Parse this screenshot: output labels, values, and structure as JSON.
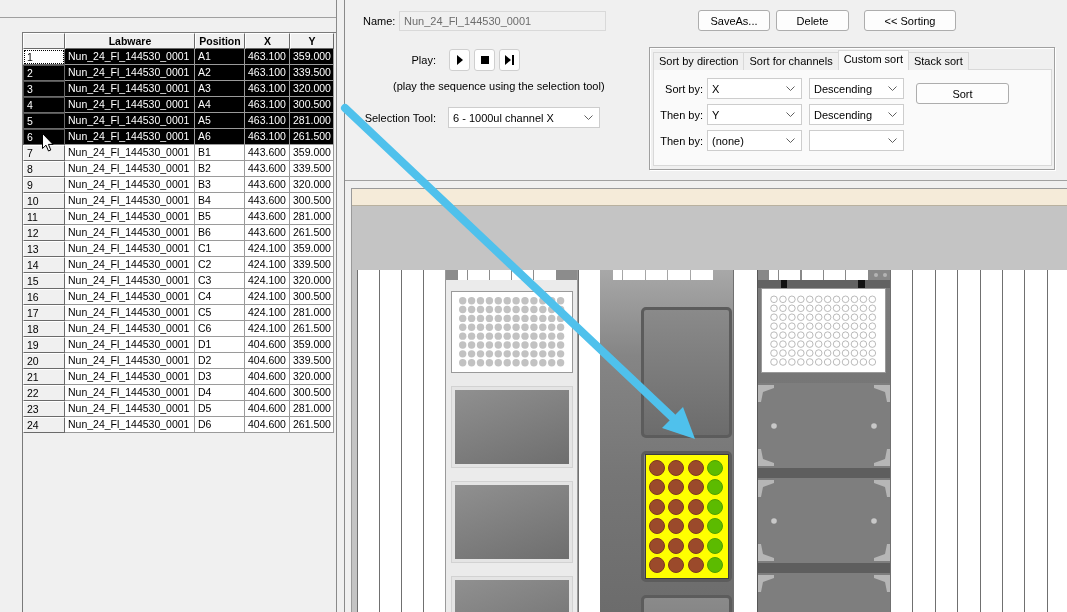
{
  "table": {
    "columns": [
      "Labware",
      "Position",
      "X",
      "Y"
    ],
    "rows": [
      {
        "number": "1",
        "cells": [
          "Nun_24_Fl_144530_0001",
          "A1",
          "463.100",
          "359.000"
        ],
        "selected": true,
        "focused": true
      },
      {
        "number": "2",
        "cells": [
          "Nun_24_Fl_144530_0001",
          "A2",
          "463.100",
          "339.500"
        ],
        "selected": true,
        "focused": false
      },
      {
        "number": "3",
        "cells": [
          "Nun_24_Fl_144530_0001",
          "A3",
          "463.100",
          "320.000"
        ],
        "selected": true,
        "focused": false
      },
      {
        "number": "4",
        "cells": [
          "Nun_24_Fl_144530_0001",
          "A4",
          "463.100",
          "300.500"
        ],
        "selected": true,
        "focused": false
      },
      {
        "number": "5",
        "cells": [
          "Nun_24_Fl_144530_0001",
          "A5",
          "463.100",
          "281.000"
        ],
        "selected": true,
        "focused": false
      },
      {
        "number": "6",
        "cells": [
          "Nun_24_Fl_144530_0001",
          "A6",
          "463.100",
          "261.500"
        ],
        "selected": true,
        "focused": false
      },
      {
        "number": "7",
        "cells": [
          "Nun_24_Fl_144530_0001",
          "B1",
          "443.600",
          "359.000"
        ],
        "selected": false,
        "focused": false
      },
      {
        "number": "8",
        "cells": [
          "Nun_24_Fl_144530_0001",
          "B2",
          "443.600",
          "339.500"
        ],
        "selected": false,
        "focused": false
      },
      {
        "number": "9",
        "cells": [
          "Nun_24_Fl_144530_0001",
          "B3",
          "443.600",
          "320.000"
        ],
        "selected": false,
        "focused": false
      },
      {
        "number": "10",
        "cells": [
          "Nun_24_Fl_144530_0001",
          "B4",
          "443.600",
          "300.500"
        ],
        "selected": false,
        "focused": false
      },
      {
        "number": "11",
        "cells": [
          "Nun_24_Fl_144530_0001",
          "B5",
          "443.600",
          "281.000"
        ],
        "selected": false,
        "focused": false
      },
      {
        "number": "12",
        "cells": [
          "Nun_24_Fl_144530_0001",
          "B6",
          "443.600",
          "261.500"
        ],
        "selected": false,
        "focused": false
      },
      {
        "number": "13",
        "cells": [
          "Nun_24_Fl_144530_0001",
          "C1",
          "424.100",
          "359.000"
        ],
        "selected": false,
        "focused": false
      },
      {
        "number": "14",
        "cells": [
          "Nun_24_Fl_144530_0001",
          "C2",
          "424.100",
          "339.500"
        ],
        "selected": false,
        "focused": false
      },
      {
        "number": "15",
        "cells": [
          "Nun_24_Fl_144530_0001",
          "C3",
          "424.100",
          "320.000"
        ],
        "selected": false,
        "focused": false
      },
      {
        "number": "16",
        "cells": [
          "Nun_24_Fl_144530_0001",
          "C4",
          "424.100",
          "300.500"
        ],
        "selected": false,
        "focused": false
      },
      {
        "number": "17",
        "cells": [
          "Nun_24_Fl_144530_0001",
          "C5",
          "424.100",
          "281.000"
        ],
        "selected": false,
        "focused": false
      },
      {
        "number": "18",
        "cells": [
          "Nun_24_Fl_144530_0001",
          "C6",
          "424.100",
          "261.500"
        ],
        "selected": false,
        "focused": false
      },
      {
        "number": "19",
        "cells": [
          "Nun_24_Fl_144530_0001",
          "D1",
          "404.600",
          "359.000"
        ],
        "selected": false,
        "focused": false
      },
      {
        "number": "20",
        "cells": [
          "Nun_24_Fl_144530_0001",
          "D2",
          "404.600",
          "339.500"
        ],
        "selected": false,
        "focused": false
      },
      {
        "number": "21",
        "cells": [
          "Nun_24_Fl_144530_0001",
          "D3",
          "404.600",
          "320.000"
        ],
        "selected": false,
        "focused": false
      },
      {
        "number": "22",
        "cells": [
          "Nun_24_Fl_144530_0001",
          "D4",
          "404.600",
          "300.500"
        ],
        "selected": false,
        "focused": false
      },
      {
        "number": "23",
        "cells": [
          "Nun_24_Fl_144530_0001",
          "D5",
          "404.600",
          "281.000"
        ],
        "selected": false,
        "focused": false
      },
      {
        "number": "24",
        "cells": [
          "Nun_24_Fl_144530_0001",
          "D6",
          "404.600",
          "261.500"
        ],
        "selected": false,
        "focused": false
      }
    ]
  },
  "name_field": {
    "label": "Name:",
    "value": "Nun_24_Fl_144530_0001",
    "disabled": true
  },
  "buttons": [
    "SaveAs...",
    "Delete",
    "<< Sorting"
  ],
  "play": {
    "label": "Play:",
    "buttons": [
      {
        "kind": "play"
      },
      {
        "kind": "stop"
      },
      {
        "kind": "step"
      }
    ],
    "hint": "(play the sequence using the selection tool)"
  },
  "selection_tool": {
    "label": "Selection Tool:",
    "value": "6 - 1000ul channel X"
  },
  "sort_panel": {
    "tabs": [
      {
        "label": "Sort by direction",
        "selected": false
      },
      {
        "label": "Sort for channels",
        "selected": false
      },
      {
        "label": "Custom sort",
        "selected": true
      },
      {
        "label": "Stack sort",
        "selected": false
      }
    ],
    "rows": [
      {
        "label": "Sort by:",
        "field": "X",
        "order": "Descending"
      },
      {
        "label": "Then by:",
        "field": "Y",
        "order": "Descending"
      },
      {
        "label": "Then by:",
        "field": "(none)"
      }
    ],
    "button": "Sort"
  },
  "deck": {
    "carriers": [
      {
        "kind": "light",
        "slots": [
          {
            "kind": "plate96",
            "filled": true
          },
          {
            "kind": "empty"
          },
          {
            "kind": "empty"
          },
          {
            "kind": "empty"
          }
        ]
      },
      {
        "kind": "dark",
        "slots": [
          {
            "kind": "holder"
          },
          {
            "kind": "plate24",
            "highlighted": true,
            "well_rows": [
              {
                "wells": [
                  {
                    "selected": false
                  },
                  {
                    "selected": false
                  },
                  {
                    "selected": false
                  },
                  {
                    "selected": true
                  }
                ]
              },
              {
                "wells": [
                  {
                    "selected": false
                  },
                  {
                    "selected": false
                  },
                  {
                    "selected": false
                  },
                  {
                    "selected": true
                  }
                ]
              },
              {
                "wells": [
                  {
                    "selected": false
                  },
                  {
                    "selected": false
                  },
                  {
                    "selected": false
                  },
                  {
                    "selected": true
                  }
                ]
              },
              {
                "wells": [
                  {
                    "selected": false
                  },
                  {
                    "selected": false
                  },
                  {
                    "selected": false
                  },
                  {
                    "selected": true
                  }
                ]
              },
              {
                "wells": [
                  {
                    "selected": false
                  },
                  {
                    "selected": false
                  },
                  {
                    "selected": false
                  },
                  {
                    "selected": true
                  }
                ]
              },
              {
                "wells": [
                  {
                    "selected": false
                  },
                  {
                    "selected": false
                  },
                  {
                    "selected": false
                  },
                  {
                    "selected": true
                  }
                ]
              }
            ]
          },
          {
            "kind": "holder"
          }
        ]
      },
      {
        "kind": "clip",
        "slots": [
          {
            "kind": "plate96",
            "filled": false
          },
          {
            "kind": "clip"
          },
          {
            "kind": "clip"
          },
          {
            "kind": "clip"
          }
        ]
      }
    ]
  }
}
